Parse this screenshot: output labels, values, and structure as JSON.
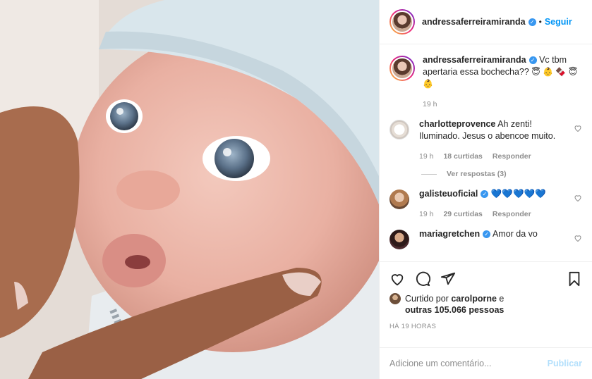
{
  "post": {
    "author": "andressaferreiramiranda",
    "follow_label": "Seguir",
    "dot": "•",
    "image_alt": "baby photo"
  },
  "caption": {
    "username": "andressaferreiramiranda",
    "text": "Vc tbm apertaria essa bochecha??",
    "emojis": "😇 👶 🍫 😇 👶",
    "time": "19 h"
  },
  "comments": [
    {
      "username": "charlotteprovence",
      "text": "Ah zenti! Iluminado. Jesus o abencoe muito.",
      "time": "19 h",
      "likes": "18 curtidas",
      "reply_label": "Responder",
      "view_replies": "Ver respostas (3)"
    },
    {
      "username": "galisteuoficial",
      "text": "💙💙💙💙💙",
      "time": "19 h",
      "likes": "29 curtidas",
      "reply_label": "Responder"
    },
    {
      "username": "mariagretchen",
      "text": "Amor da vo"
    }
  ],
  "likes": {
    "prefix": "Curtido por",
    "user": "carolporne",
    "conj": "e",
    "others": "outras 105.066 pessoas"
  },
  "timestamp": "HÁ 19 HORAS",
  "add_comment": {
    "placeholder": "Adicione um comentário...",
    "publish_label": "Publicar"
  },
  "icons": [
    "heart-icon",
    "comment-icon",
    "share-icon",
    "bookmark-icon",
    "verified-icon"
  ],
  "colors": {
    "accent": "#0095f6",
    "publish_disabled": "#b2dffc",
    "muted": "#8e8e8e",
    "verified": "#3897f0",
    "heart_blue": "#2ab8e6"
  }
}
